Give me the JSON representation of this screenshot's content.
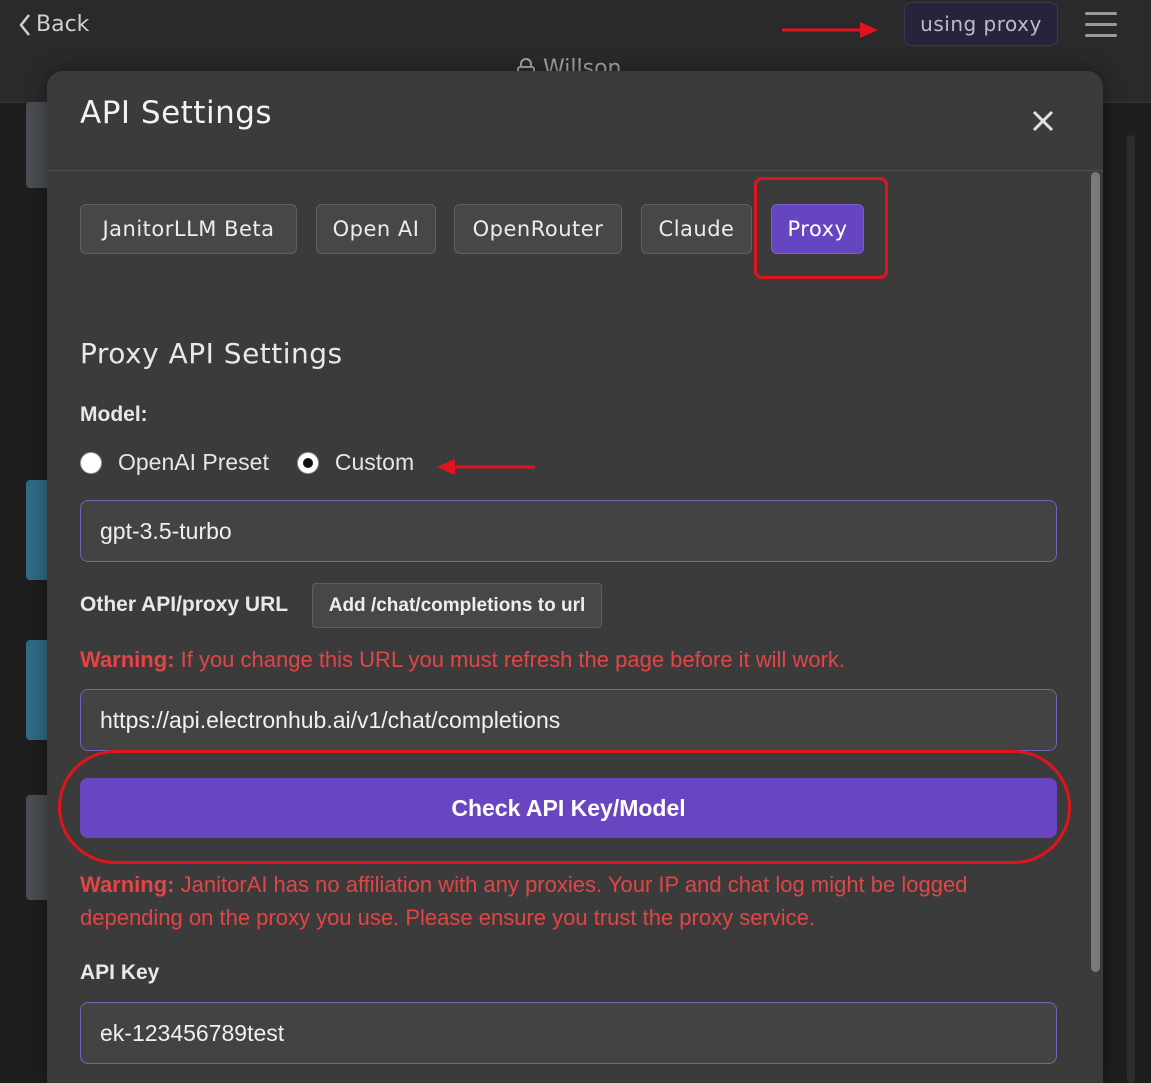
{
  "topbar": {
    "back_label": "Back",
    "proxy_badge": "using proxy",
    "character_name": "Willson"
  },
  "modal": {
    "title": "API Settings",
    "tabs": [
      {
        "label": "JanitorLLM Beta",
        "active": false
      },
      {
        "label": "Open AI",
        "active": false
      },
      {
        "label": "OpenRouter",
        "active": false
      },
      {
        "label": "Claude",
        "active": false
      },
      {
        "label": "Proxy",
        "active": true
      }
    ],
    "section_title": "Proxy API Settings",
    "model": {
      "label": "Model:",
      "options": [
        {
          "label": "OpenAI Preset",
          "checked": false
        },
        {
          "label": "Custom",
          "checked": true
        }
      ],
      "value": "gpt-3.5-turbo"
    },
    "proxy_url": {
      "label": "Other API/proxy URL",
      "add_button": "Add /chat/completions to url",
      "warning_prefix": "Warning:",
      "warning_text": " If you change this URL you must refresh the page before it will work.",
      "value": "https://api.electronhub.ai/v1/chat/completions"
    },
    "check_button": "Check API Key/Model",
    "affiliation_warning": {
      "prefix": "Warning:",
      "text": " JanitorAI has no affiliation with any proxies. Your IP and chat log might be logged depending on the proxy you use. Please ensure you trust the proxy service."
    },
    "api_key": {
      "label": "API Key",
      "value": "ek-123456789test"
    }
  },
  "colors": {
    "accent": "#6645c1",
    "warning": "#e34545",
    "annotation": "#e1141d"
  }
}
